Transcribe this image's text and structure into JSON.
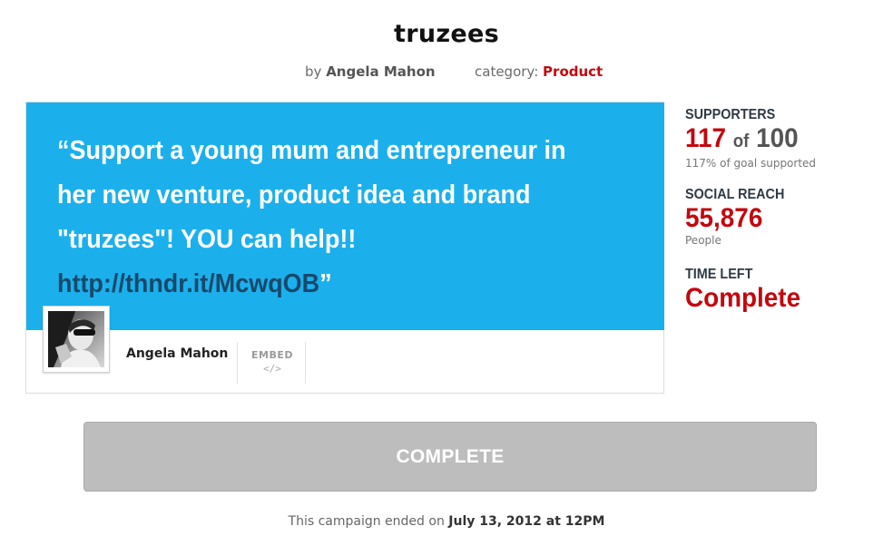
{
  "campaign": {
    "title": "truzees",
    "by_prefix": "by",
    "author": "Angela Mahon",
    "category_prefix": "category:",
    "category": "Product"
  },
  "card": {
    "quote_open": "“",
    "quote_text": "Support a young mum and entrepreneur in her new venture, product idea and brand \"truzees\"! YOU can help!!",
    "quote_link": "http://thndr.it/McwqOB",
    "quote_close": "”",
    "author_name": "Angela Mahon",
    "embed_label": "EMBED",
    "embed_icon": "</>"
  },
  "stats": {
    "supporters_label": "SUPPORTERS",
    "supporters_count": "117",
    "supporters_of": "of",
    "supporters_goal": "100",
    "supporters_sub": "117% of goal supported",
    "reach_label": "SOCIAL REACH",
    "reach_value": "55,876",
    "reach_sub": "People",
    "time_label": "TIME LEFT",
    "time_value": "Complete"
  },
  "button": {
    "label": "COMPLETE"
  },
  "footer": {
    "ended_prefix": "This campaign ended on",
    "ended_date": "July 13, 2012 at 12PM"
  },
  "colors": {
    "accent_red": "#c3080e",
    "quote_blue": "#1bb0ec",
    "link_navy": "#17496b",
    "button_grey": "#bdbdbd"
  },
  "icons": [
    "code-icon",
    "avatar-photo"
  ]
}
